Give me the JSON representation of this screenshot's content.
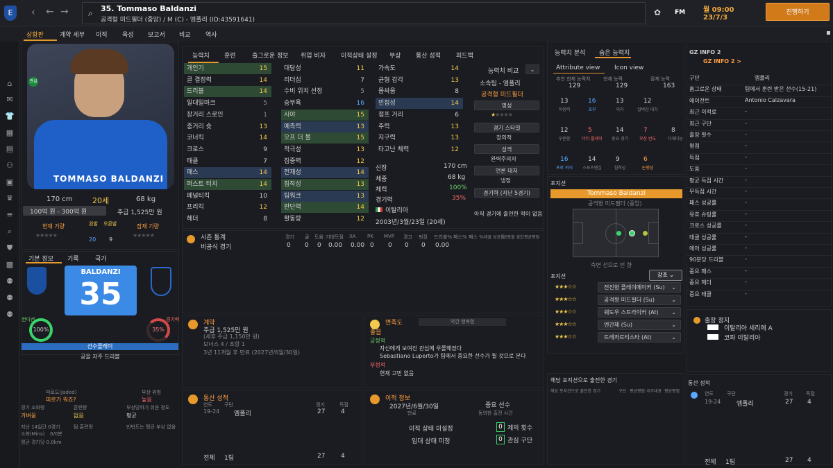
{
  "header": {
    "player_title": "35. Tommaso Baldanzi",
    "subtitle": "공격형 미드필더 (중앙) / M (C) - 엠폴리 (ID:43591641)",
    "game_date": "월 09:00",
    "game_date2": "23/7/3",
    "continue_label": "진행하기",
    "fm_label": "FM"
  },
  "nav": {
    "items": [
      "상황판",
      "계약 세부",
      "이적",
      "육성",
      "보고서",
      "비교",
      "역사"
    ]
  },
  "profile": {
    "height": "170 cm",
    "age": "20세",
    "weight": "68 kg",
    "value": "100억 원 - 300억 원",
    "wage": "주급 1,525만 원",
    "current_ability_label": "현재 기량",
    "potential_ability_label": "잠재 기량",
    "left_foot_label": "왼발",
    "right_foot_label": "오른발",
    "left_foot_val": "20",
    "right_foot_val": "9",
    "jersey_name": "TOMMASO BALDANZI",
    "shirt_name": "BALDANZI",
    "shirt_number": "35",
    "tabs": [
      "기본 정보",
      "기록",
      "국가"
    ],
    "morale_label": "컨디션",
    "morale_val": "100%",
    "fitness_label": "경기력",
    "fitness_val": "35%",
    "role_bar": "선수플레이",
    "role_text": "공을 자주 드리블",
    "jaded_label": "피로도(Jaded)",
    "jaded_val": "피로가 워죠?",
    "injury_label": "부상 위험",
    "injury_val": "높음",
    "match_load_label": "경기 소화량",
    "match_load_val": "가벼움",
    "training_load_label": "훈련량",
    "training_load_val": "없음",
    "injury_prone_label": "부상당하기 쉬운 정도",
    "injury_prone_val": "평균",
    "last14_label": "지난 14일간 0경기",
    "training_sub": "팀 훈련량",
    "recent_injury": "빈번도는 평균 부상 없음",
    "distance_label": "소화(Mins)",
    "distance_val": "0/0분",
    "avg_dist": "평균 경기당 0.0km"
  },
  "attr_tabs": [
    "능력치",
    "훈련",
    "출그로운 정보",
    "취업 비자",
    "이적상태 설정",
    "부상",
    "통산 성적",
    "피드백"
  ],
  "tech": [
    {
      "n": "개인기",
      "v": "15",
      "c": "yel",
      "hl": true
    },
    {
      "n": "골 결정력",
      "v": "14",
      "c": "yel",
      "hl": false
    },
    {
      "n": "드리블",
      "v": "14",
      "c": "yel",
      "hl": true
    },
    {
      "n": "일대일마크",
      "v": "5",
      "c": "dim",
      "hl": false
    },
    {
      "n": "장거리 스로인",
      "v": "1",
      "c": "dim",
      "hl": false
    },
    {
      "n": "중거리 슛",
      "v": "13",
      "c": "yel",
      "hl": false
    },
    {
      "n": "코너킥",
      "v": "14",
      "c": "yel",
      "hl": false
    },
    {
      "n": "크로스",
      "v": "9",
      "c": "lab",
      "hl": false
    },
    {
      "n": "태클",
      "v": "7",
      "c": "lab",
      "hl": false
    },
    {
      "n": "패스",
      "v": "14",
      "c": "yel",
      "hl": true
    },
    {
      "n": "퍼스트 터치",
      "v": "14",
      "c": "yel",
      "hl": true
    },
    {
      "n": "페널티킥",
      "v": "10",
      "c": "lab",
      "hl": false
    },
    {
      "n": "프리킥",
      "v": "12",
      "c": "yel",
      "hl": false
    },
    {
      "n": "헤더",
      "v": "8",
      "c": "lab",
      "hl": false
    }
  ],
  "mental": [
    {
      "n": "대담성",
      "v": "11",
      "c": "yel",
      "hl": false
    },
    {
      "n": "리더십",
      "v": "7",
      "c": "lab",
      "hl": false
    },
    {
      "n": "수비 위치 선정",
      "v": "5",
      "c": "dim",
      "hl": false
    },
    {
      "n": "승부욕",
      "v": "16",
      "c": "blu",
      "hl": false
    },
    {
      "n": "시야",
      "v": "15",
      "c": "yel",
      "hl": true
    },
    {
      "n": "예측력",
      "v": "13",
      "c": "yel",
      "hl": true
    },
    {
      "n": "오프 더 볼",
      "v": "15",
      "c": "yel",
      "hl": true
    },
    {
      "n": "적극성",
      "v": "13",
      "c": "yel",
      "hl": false
    },
    {
      "n": "집중력",
      "v": "12",
      "c": "yel",
      "hl": false
    },
    {
      "n": "전재성",
      "v": "14",
      "c": "yel",
      "hl": true
    },
    {
      "n": "침착성",
      "v": "13",
      "c": "yel",
      "hl": true
    },
    {
      "n": "팀워크",
      "v": "13",
      "c": "yel",
      "hl": true
    },
    {
      "n": "판단력",
      "v": "14",
      "c": "yel",
      "hl": true
    },
    {
      "n": "활동량",
      "v": "12",
      "c": "yel",
      "hl": false
    }
  ],
  "physical": [
    {
      "n": "가속도",
      "v": "14",
      "c": "yel",
      "hl": false
    },
    {
      "n": "균형 감각",
      "v": "13",
      "c": "yel",
      "hl": false
    },
    {
      "n": "몸싸움",
      "v": "8",
      "c": "lab",
      "hl": false
    },
    {
      "n": "민첩성",
      "v": "14",
      "c": "yel",
      "hl": true
    },
    {
      "n": "점프 거리",
      "v": "6",
      "c": "lab",
      "hl": false
    },
    {
      "n": "주력",
      "v": "13",
      "c": "yel",
      "hl": false
    },
    {
      "n": "지구력",
      "v": "13",
      "c": "yel",
      "hl": false
    },
    {
      "n": "타고난 체력",
      "v": "12",
      "c": "yel",
      "hl": false
    }
  ],
  "info_box": [
    [
      "신장",
      "170 cm"
    ],
    [
      "체중",
      "68 kg"
    ],
    [
      "체력",
      "100%"
    ],
    [
      "경기력",
      "35%"
    ],
    [
      "국적",
      "이탈리아"
    ],
    [
      "",
      "2003년/3월/23일 (20세)"
    ]
  ],
  "compare": {
    "label": "능력치 비교",
    "club": "소속팀 - 엠폴리",
    "position": "공격형 미드필더",
    "rep_label": "명성",
    "style_label": "경기 스타일",
    "style_val": "창의적",
    "pers_label": "성격",
    "pers_val": "완벽주의자",
    "media_label": "언론 대처",
    "media_val": "냉정",
    "form_label": "경기력 (지난 5경기)",
    "form_val": "아직 경기에 출전한 적이 없음"
  },
  "season": {
    "label": "시즌 통계",
    "cols": [
      "경기",
      "골",
      "도움",
      "기대득점",
      "XA",
      "PK",
      "MVP",
      "경고",
      "퇴장",
      "드리블%",
      "패스%",
      "패스 %",
      "태클 성공률",
      "공중볼 경합",
      "평균평점"
    ],
    "row_label": "비공식 경기",
    "row_vals": [
      "0",
      "0",
      "0",
      "0.00",
      "0.00",
      "0",
      "0",
      "0",
      "0",
      "0.00"
    ]
  },
  "contract": {
    "label": "계약",
    "wage": "주급 1,525만 원",
    "wage_sub": "(세후 주급 1,150만 원)",
    "bonus": "보너스 4 / 조항 1",
    "expiry": "3년 11개월 후 만료 (2027년/6월/30일)"
  },
  "interaction": {
    "label": "면족도",
    "sub": "약간 행복함",
    "overall": "좋음",
    "pos_label": "긍정적",
    "pos": [
      "자신에게 보여진 관심에 우쭐해졌다",
      "Sebastiano Luperto가 팀에서 중요한 선수가 될 것으로 본다"
    ],
    "neg_label": "부정적",
    "neg": [
      "현재 고민 없음"
    ]
  },
  "history_left": {
    "label": "통산 성적",
    "cols": [
      "연도",
      "구단",
      "경기",
      "득점"
    ],
    "rows": [
      [
        "19-24",
        "엠폴리",
        "27",
        "4"
      ]
    ],
    "total_label": "전체",
    "total_club": "1팀",
    "total_games": "27",
    "total_goals": "4"
  },
  "transfer": {
    "label": "이적 정보",
    "date": "2027년/6월/30일",
    "date_sub": "만료",
    "important": "중요 선수",
    "important_sub": "동의한 출전 시간",
    "status_label": "이적 상태 미설정",
    "status_label2": "임대 상태 미정",
    "offers_label": "제의 횟수",
    "offers_val": "0",
    "interest_label": "관심 구단",
    "interest_val": "0"
  },
  "analysis": {
    "tabs": [
      "능력치 분석",
      "숨은 능력치"
    ],
    "view_tabs": [
      "Attribute view",
      "Icon view"
    ],
    "top": [
      [
        "추천 현재 능력치",
        "129"
      ],
      [
        "현재 능력",
        "129"
      ],
      [
        "잠재 능력",
        "163"
      ]
    ],
    "grid": [
      [
        "13",
        "적응력",
        "lab"
      ],
      [
        "16",
        "포부",
        "blu"
      ],
      [
        "13",
        "의리",
        "lab"
      ],
      [
        "12",
        "압박감 대처",
        "lab"
      ],
      [
        "12",
        "꾸준함",
        "lab"
      ],
      [
        "5",
        "더티 플레이",
        "red"
      ],
      [
        "14",
        "중요 경기",
        "lab"
      ],
      [
        "7",
        "부상 빈도",
        "red"
      ],
      [
        "8",
        "다재다능",
        "lab"
      ],
      [
        "16",
        "프로 의식",
        "blu"
      ],
      [
        "14",
        "스포츠맨십",
        "lab"
      ],
      [
        "9",
        "침착성",
        "lab"
      ],
      [
        "6",
        "논쟁성",
        "org"
      ]
    ]
  },
  "position": {
    "label": "포지션",
    "name_bar": "Tommaso Baldanzi",
    "name_sub": "공격형 미드필더 (중앙)",
    "pitch_caption": "측면 선으로 인 향",
    "roles_label": "포지션",
    "emphasis_label": "강조",
    "roles": [
      "전진형 플레이메이커 (Su)",
      "공격형 미드필더 (Su)",
      "쉐도우 스트라이커 (At)",
      "엔간체 (Su)",
      "트레콰르티스타 (At)"
    ],
    "role_stars": [
      "3",
      "3",
      "3",
      "2.5",
      "2.5"
    ],
    "played_label": "해당 포지션으로 출전한 경기",
    "played_cols": [
      "해당 포지션으로 출전한 경기",
      "구단",
      "평균평점",
      "국가대표",
      "평균평점"
    ]
  },
  "gz": {
    "title": "GZ INFO 2",
    "link": "GZ INFO 2 >",
    "rows": [
      [
        "구단",
        "엠폴리"
      ],
      [
        "홈그로운 상태",
        "팀에서 훈련 받은 선수(15-21)"
      ],
      [
        "에이전트",
        "Antonio Calzavara"
      ],
      [
        "최근 이적료",
        "-"
      ],
      [
        "최근 구단",
        "-"
      ],
      [
        "출장 횟수",
        "-"
      ],
      [
        "평점",
        "-"
      ],
      [
        "득점",
        "-"
      ],
      [
        "도움",
        "-"
      ],
      [
        "평균 득점 시간",
        "-"
      ],
      [
        "무득점 시간",
        "-"
      ],
      [
        "패스 성공률",
        "-"
      ],
      [
        "유효 슈팅률",
        "-"
      ],
      [
        "크로스 성공률",
        "-"
      ],
      [
        "태클 성공률",
        "-"
      ],
      [
        "에어 성공률",
        "-"
      ],
      [
        "90분당 드리블",
        "-"
      ],
      [
        "중요 패스",
        "-"
      ],
      [
        "중요 헤더",
        "-"
      ],
      [
        "중요 태클",
        "-"
      ]
    ],
    "ban_label": "출장 정지",
    "ban_items": [
      "이탈리아 세리에 A",
      "코파 이탈리아"
    ]
  },
  "history_right": {
    "label": "통산 성적",
    "cols": [
      "연도",
      "구단",
      "경기",
      "득점"
    ],
    "rows": [
      [
        "19-24",
        "엠폴리",
        "27",
        "4"
      ]
    ],
    "total_label": "전체",
    "total_club": "1팀",
    "total_games": "27",
    "total_goals": "4"
  },
  "colors": {
    "accent": "#e79a2b",
    "bg": "#1a1b1f",
    "highlight_green": "#2e4a34",
    "highlight_blue": "#2a3a52"
  }
}
